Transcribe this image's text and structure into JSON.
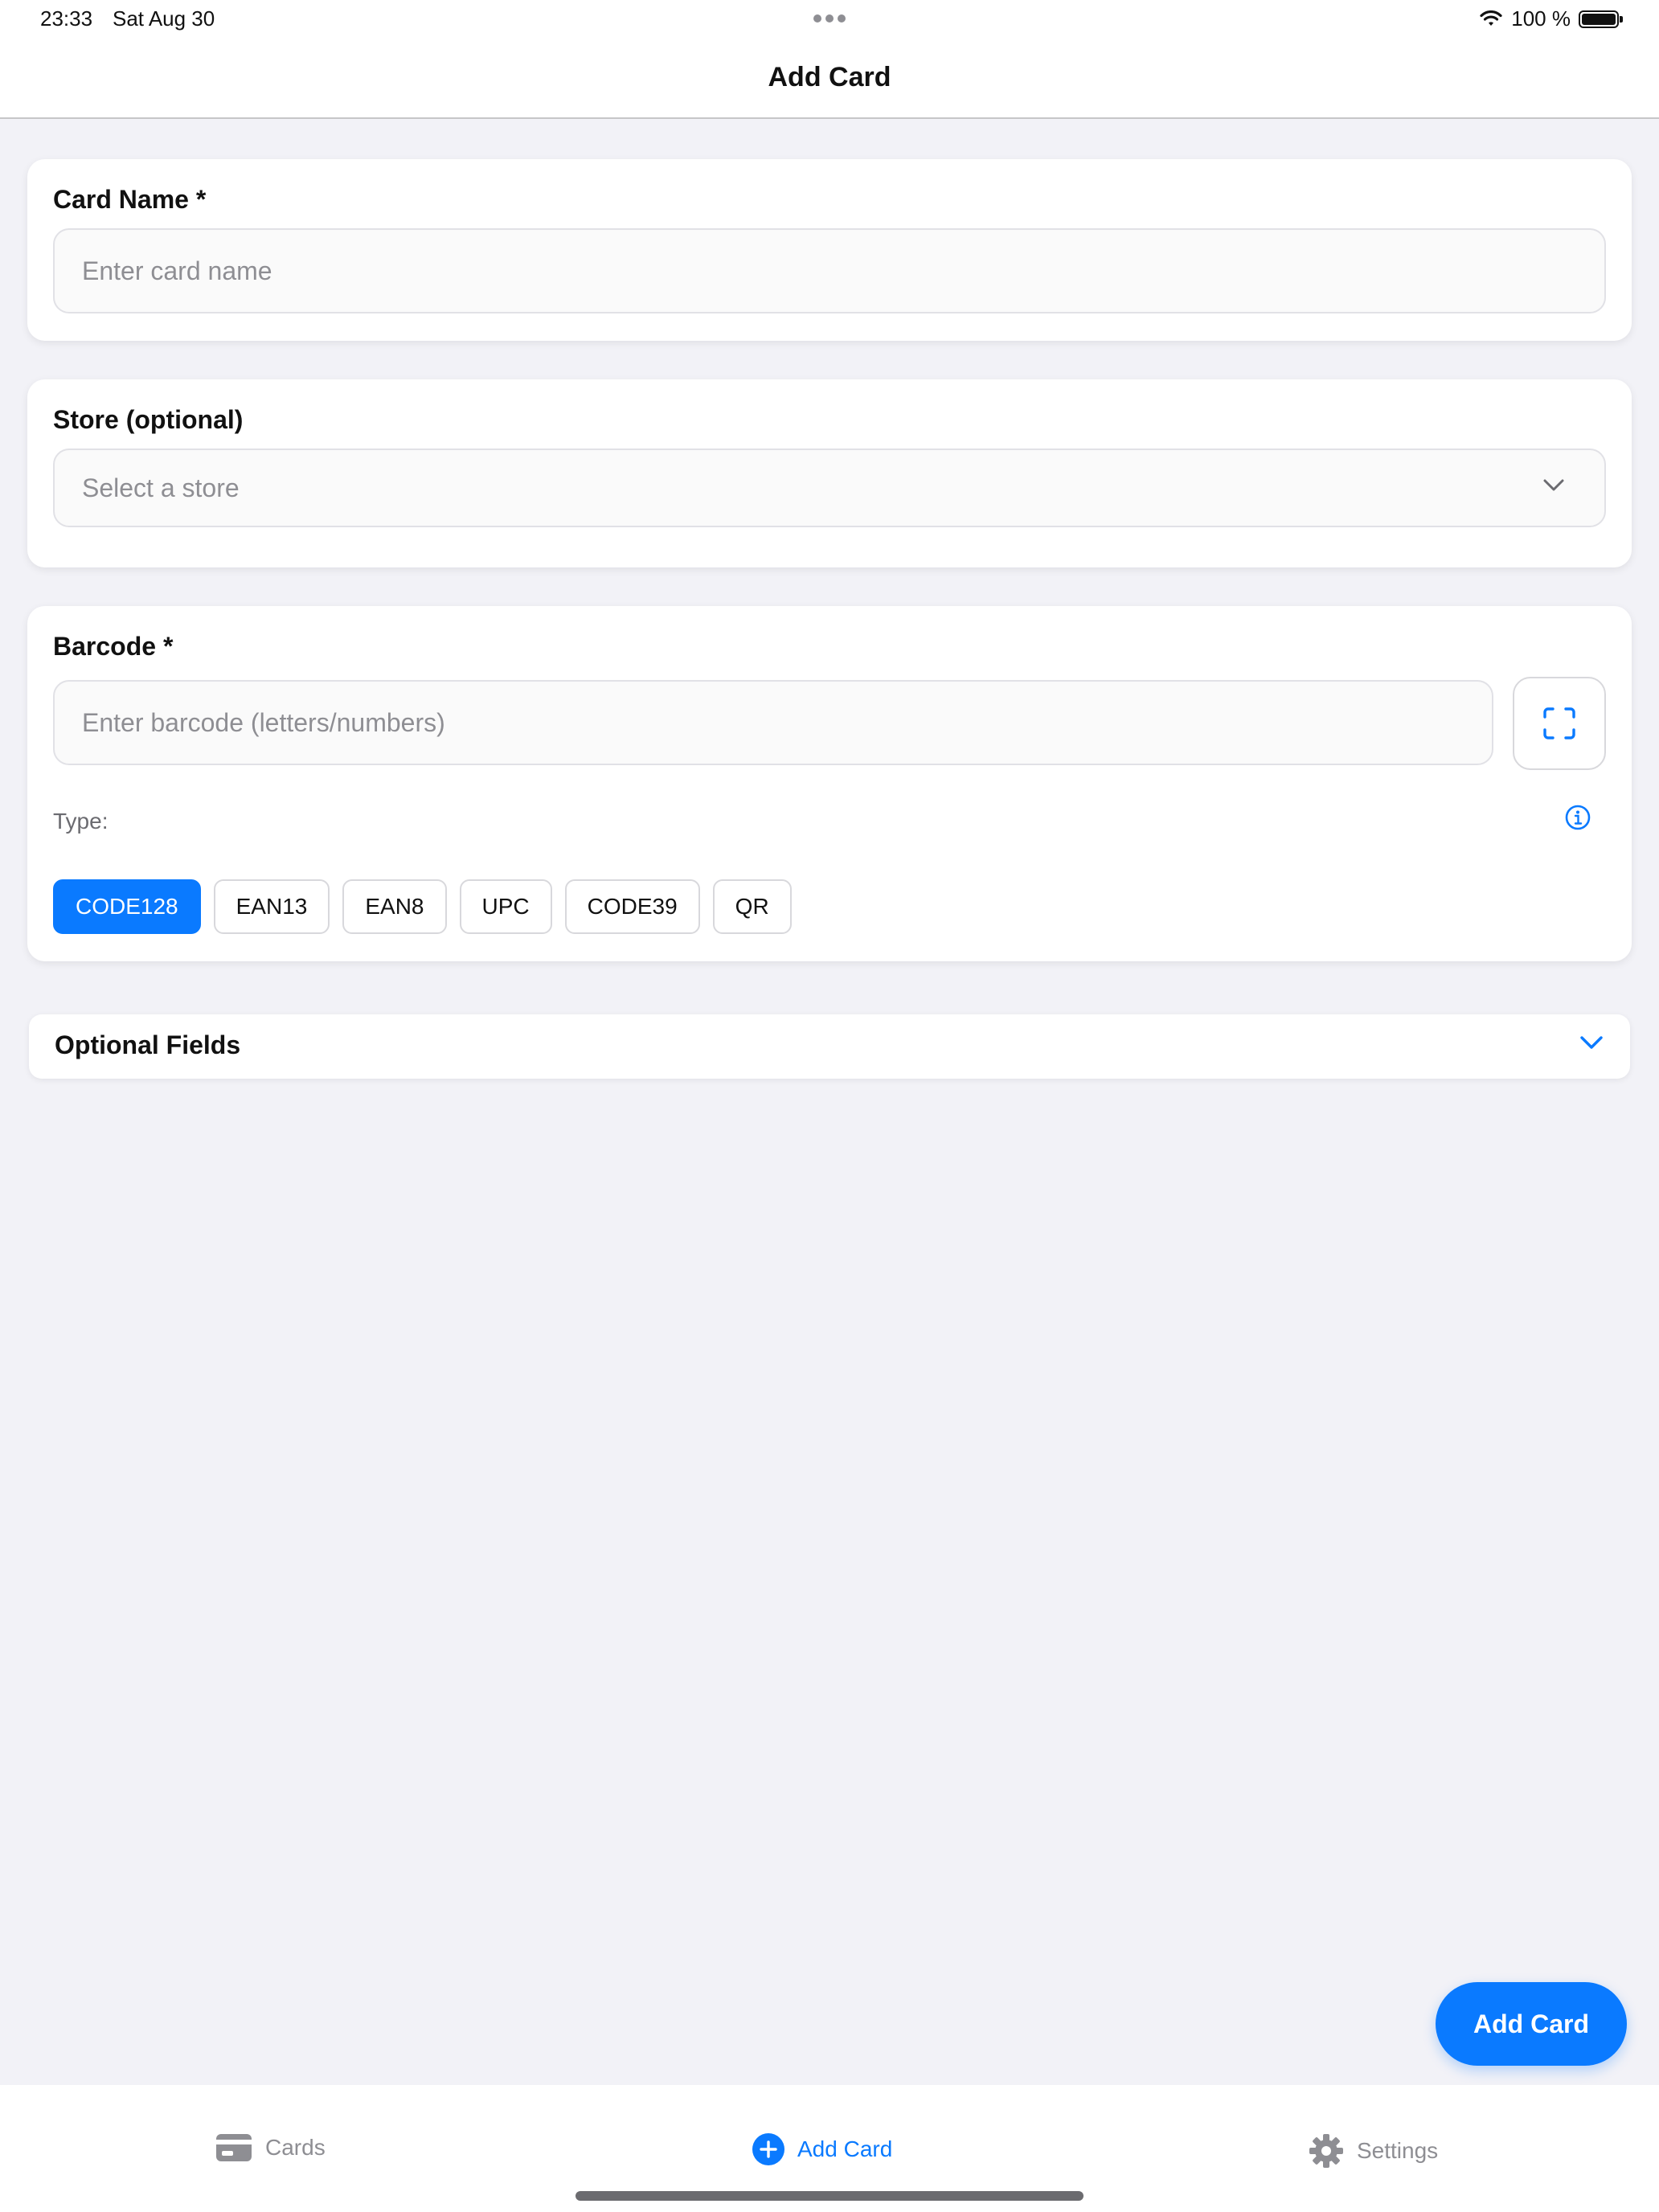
{
  "status_bar": {
    "time": "23:33",
    "date": "Sat Aug 30",
    "battery": "100 %"
  },
  "nav": {
    "title": "Add Card"
  },
  "card_name": {
    "label": "Card Name *",
    "placeholder": "Enter card name"
  },
  "store": {
    "label": "Store (optional)",
    "placeholder": "Select a store"
  },
  "barcode": {
    "label": "Barcode *",
    "placeholder": "Enter barcode (letters/numbers)",
    "type_label": "Type:",
    "types": [
      "CODE128",
      "EAN13",
      "EAN8",
      "UPC",
      "CODE39",
      "QR"
    ],
    "selected_type": "CODE128"
  },
  "optional_fields": {
    "title": "Optional Fields"
  },
  "fab": {
    "label": "Add Card"
  },
  "tabs": [
    {
      "label": "Cards",
      "icon": "credit-card-icon",
      "active": false
    },
    {
      "label": "Add Card",
      "icon": "plus-circle-icon",
      "active": true
    },
    {
      "label": "Settings",
      "icon": "gear-icon",
      "active": false
    }
  ],
  "colors": {
    "accent": "#0a7aff",
    "background": "#f2f2f7",
    "inactive": "#8e8e93"
  }
}
